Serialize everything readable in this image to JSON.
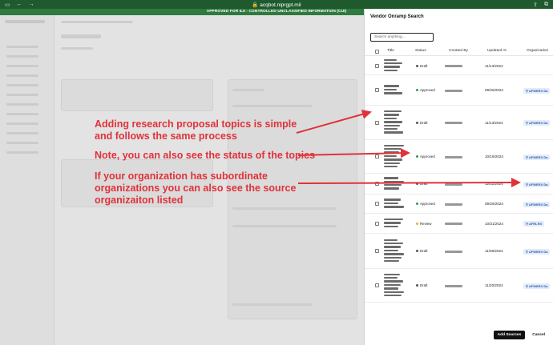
{
  "browser": {
    "url": "acqbot.niprgpt.mil",
    "banner": "APPROVED FOR IL5 - CONTROLLED UNCLASSIFIED INFORMATION (CUI)"
  },
  "drawer": {
    "title": "Vendor Onramp Search",
    "search_placeholder": "Search anything...",
    "columns": [
      "Title",
      "Status",
      "Created By",
      "Updated At",
      "Organization"
    ],
    "rows": [
      {
        "status": "Draft",
        "status_color": "#555555",
        "date": "11/13/2024",
        "org": ""
      },
      {
        "status": "Approved",
        "status_color": "#2e9b4a",
        "date": "09/25/2024",
        "org": "AFWERX Da"
      },
      {
        "status": "Draft",
        "status_color": "#555555",
        "date": "11/13/2024",
        "org": "AFWERX Da"
      },
      {
        "status": "Approved",
        "status_color": "#2e9b4a",
        "date": "10/18/2024",
        "org": "AFWERX Da"
      },
      {
        "status": "Draft",
        "status_color": "#555555",
        "date": "12/11/2024",
        "org": "AFWERX Da"
      },
      {
        "status": "Approved",
        "status_color": "#2e9b4a",
        "date": "09/25/2024",
        "org": "AFWERX Da"
      },
      {
        "status": "Review",
        "status_color": "#e6b325",
        "date": "10/31/2024",
        "org": "AFRLRX"
      },
      {
        "status": "Draft",
        "status_color": "#555555",
        "date": "11/06/2024",
        "org": "AFWERX Da"
      },
      {
        "status": "Draft",
        "status_color": "#555555",
        "date": "11/20/2024",
        "org": "AFWERX Da"
      }
    ],
    "add_label": "Add Sources",
    "cancel_label": "Cancel"
  },
  "annotations": {
    "a1": "Adding research proposal topics is simple and follows the same process",
    "a2": "Note, you can also see the status of the topics",
    "a3": "If your organization has subordinate organizations you can also see the source organizaiton listed",
    "color": "#e0323a"
  }
}
